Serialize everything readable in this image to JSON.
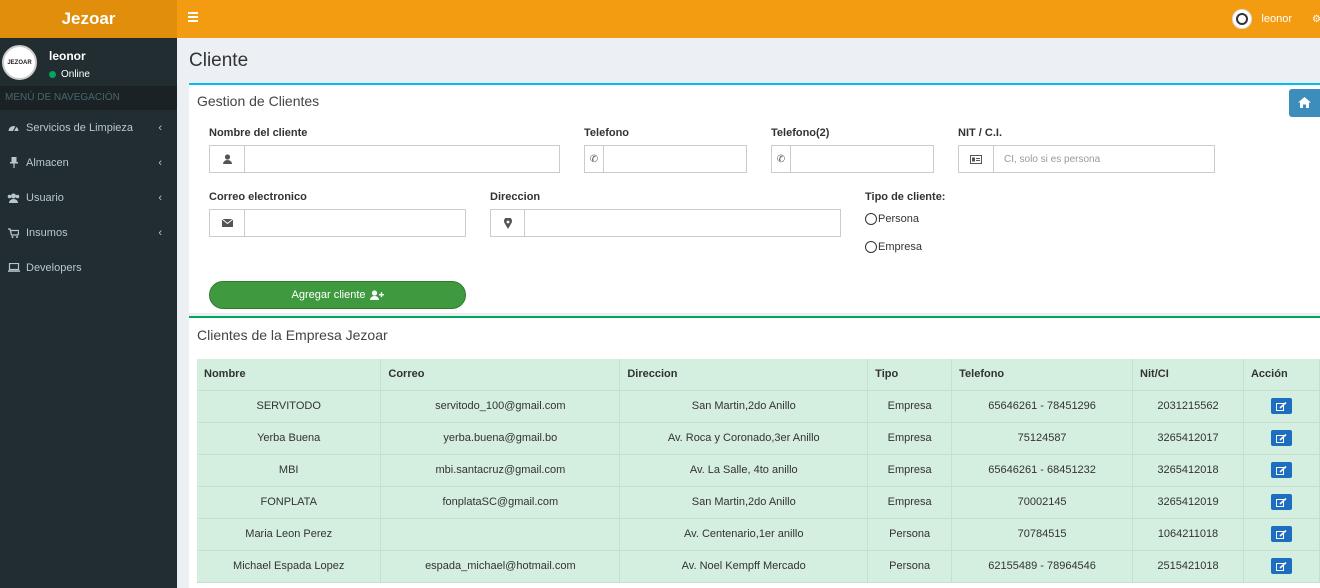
{
  "app": {
    "name": "Jezoar",
    "user": "leonor",
    "status": "Online"
  },
  "sidebar": {
    "header": "MENÚ DE NAVEGACIÓN",
    "items": [
      {
        "label": "Servicios de Limpieza",
        "icon": "dashboard-icon"
      },
      {
        "label": "Almacen",
        "icon": "thumbtack-icon"
      },
      {
        "label": "Usuario",
        "icon": "users-icon"
      },
      {
        "label": "Insumos",
        "icon": "cart-icon"
      },
      {
        "label": "Developers",
        "icon": "laptop-icon"
      }
    ]
  },
  "page": {
    "title": "Cliente"
  },
  "form": {
    "title": "Gestion de Clientes",
    "nombre_label": "Nombre del cliente",
    "telefono_label": "Telefono",
    "telefono2_label": "Telefono(2)",
    "nit_label": "NIT / C.I.",
    "nit_placeholder": "CI, solo si es persona",
    "correo_label": "Correo electronico",
    "direccion_label": "Direccion",
    "tipo_label": "Tipo de cliente:",
    "tipo_persona": "Persona",
    "tipo_empresa": "Empresa",
    "submit_label": "Agregar cliente"
  },
  "table": {
    "title": "Clientes de la Empresa Jezoar",
    "headers": [
      "Nombre",
      "Correo",
      "Direccion",
      "Tipo",
      "Telefono",
      "Nit/CI",
      "Acción"
    ],
    "rows": [
      [
        "SERVITODO",
        "servitodo_100@gmail.com",
        "San Martin,2do Anillo",
        "Empresa",
        "65646261 - 78451296",
        "2031215562"
      ],
      [
        "Yerba Buena",
        "yerba.buena@gmail.bo",
        "Av. Roca y Coronado,3er Anillo",
        "Empresa",
        "75124587",
        "3265412017"
      ],
      [
        "MBI",
        "mbi.santacruz@gmail.com",
        "Av. La Salle, 4to anillo",
        "Empresa",
        "65646261 - 68451232",
        "3265412018"
      ],
      [
        "FONPLATA",
        "fonplataSC@gmail.com",
        "San Martin,2do Anillo",
        "Empresa",
        "70002145",
        "3265412019"
      ],
      [
        "Maria Leon Perez",
        "",
        "Av. Centenario,1er anillo",
        "Persona",
        "70784515",
        "1064211018"
      ],
      [
        "Michael Espada Lopez",
        "espada_michael@hotmail.com",
        "Av. Noel Kempff Mercado",
        "Persona",
        "62155489 - 78964546",
        "2515421018"
      ]
    ]
  },
  "colors": {
    "topbar": "#f39c12",
    "logo_bg": "#e08e0b",
    "sidebar": "#222d32",
    "primary": "#3c8dbc",
    "success": "#3f9a3f",
    "table_bg": "#d4eee0"
  }
}
